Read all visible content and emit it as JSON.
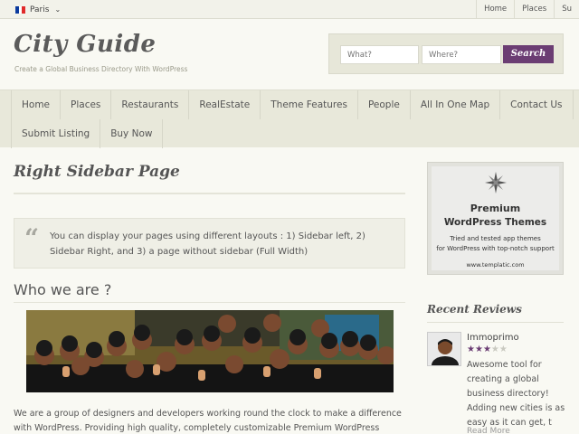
{
  "topbar": {
    "city": "Paris",
    "flag_colors": [
      "#0b3b9e",
      "#ffffff",
      "#e02a2a"
    ],
    "links": [
      "Home",
      "Places",
      "Su"
    ]
  },
  "header": {
    "title": "City Guide",
    "tagline": "Create a Global Business Directory With WordPress"
  },
  "search": {
    "what_placeholder": "What?",
    "where_placeholder": "Where?",
    "button_label": "Search",
    "accent": "#6b3d73"
  },
  "nav": {
    "row1": [
      "Home",
      "Places",
      "Restaurants",
      "RealEstate",
      "Theme Features",
      "People",
      "All In One Map",
      "Contact Us"
    ],
    "row2": [
      "Submit Listing",
      "Buy Now"
    ]
  },
  "main": {
    "page_title": "Right Sidebar Page",
    "quote_mark": "“",
    "quote_text": "You can display your pages using different layouts : 1) Sidebar left, 2) Sidebar Right, and 3) a page without sidebar (Full Width)",
    "section_title": "Who we are ?",
    "body_text": "We are a group of designers and developers working round the clock to make a difference with WordPress. Providing high quality, completely customizable Premium WordPress themes is what Templatic"
  },
  "sidebar": {
    "ad": {
      "heading1": "Premium",
      "heading2": "WordPress Themes",
      "sub1": "Tried and tested app themes",
      "sub2": "for WordPress with top-notch support",
      "url": "www.templatic.com"
    },
    "recent_reviews_title": "Recent Reviews",
    "review": {
      "name": "Immoprimo",
      "rating": 3,
      "max_rating": 5,
      "text": "Awesome tool for creating a global business directory! Adding new cities is as easy as it can get, t",
      "read_more": "Read More"
    }
  }
}
